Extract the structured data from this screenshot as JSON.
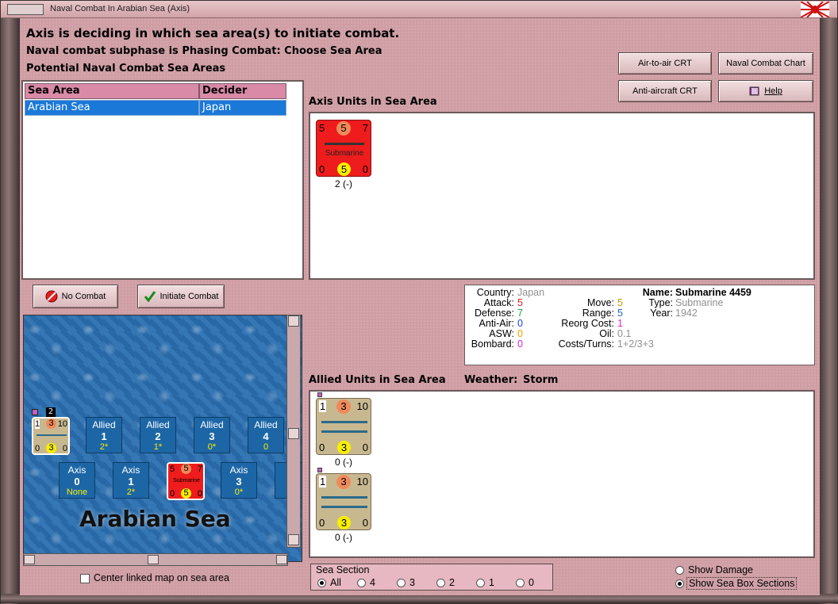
{
  "window": {
    "title": "Naval Combat In Arabian Sea (Axis)"
  },
  "status": {
    "line1": "Axis is deciding in which sea area(s) to initiate combat.",
    "line2": "Naval combat subphase is Phasing Combat: Choose Sea Area",
    "line3": "Potential Naval Combat Sea Areas"
  },
  "buttons": {
    "air_to_air": "Air-to-air CRT",
    "naval_chart": "Naval Combat Chart",
    "anti_aircraft": "Anti-aircraft CRT",
    "help": "Help",
    "no_combat": "No Combat",
    "initiate": "Initiate Combat"
  },
  "table": {
    "headers": [
      "Sea Area",
      "Decider"
    ],
    "rows": [
      [
        "Arabian Sea",
        "Japan"
      ]
    ]
  },
  "axis_section": {
    "label": "Axis Units in Sea Area"
  },
  "axis_unit": {
    "top": [
      "5",
      "5",
      "7"
    ],
    "name": "Submarine",
    "bottom": [
      "0",
      "5",
      "0"
    ],
    "caption": "2 (-)"
  },
  "allied_section": {
    "label": "Allied Units in Sea Area",
    "weather_label": "Weather:",
    "weather_value": "Storm"
  },
  "allied_units": [
    {
      "top": [
        "1",
        "3",
        "10"
      ],
      "bottom": [
        "0",
        "3",
        "0"
      ],
      "caption": "0 (-)"
    },
    {
      "top": [
        "1",
        "3",
        "10"
      ],
      "bottom": [
        "0",
        "3",
        "0"
      ],
      "caption": "0 (-)"
    }
  ],
  "info": {
    "country_label": "Country:",
    "country": "Japan",
    "attack_label": "Attack:",
    "attack": "5",
    "defense_label": "Defense:",
    "defense": "7",
    "antiair_label": "Anti-Air:",
    "antiair": "0",
    "asw_label": "ASW:",
    "asw": "0",
    "bombard_label": "Bombard:",
    "bombard": "0",
    "move_label": "Move:",
    "move": "5",
    "range_label": "Range:",
    "range": "5",
    "reorg_label": "Reorg Cost:",
    "reorg": "1",
    "oil_label": "Oil:",
    "oil": "0.1",
    "costs_label": "Costs/Turns:",
    "costs": "1+2/3+3",
    "name_label": "Name:",
    "name": "Submarine 4459",
    "type_label": "Type:",
    "type": "Submarine",
    "year_label": "Year:",
    "year": "1942",
    "colors": {
      "attack": "#e02020",
      "defense": "#20a040",
      "antiair": "#2040e0",
      "asw": "#f0a000",
      "bombard": "#e020e0",
      "move": "#c0a000",
      "range": "#2060c0",
      "reorg": "#e020e0",
      "gray": "#909090"
    }
  },
  "map": {
    "name": "Arabian Sea",
    "stack_count": "2",
    "mini_counter": {
      "top": [
        "1",
        "3",
        "10"
      ],
      "bottom": [
        "0",
        "3",
        "0"
      ]
    },
    "mini_sub": {
      "top": [
        "5",
        "5",
        "7"
      ],
      "name": "Submarine",
      "bottom": [
        "0",
        "5",
        "0"
      ]
    },
    "allied_boxes": [
      {
        "name": "Allied",
        "num": "1",
        "sub": "2*"
      },
      {
        "name": "Allied",
        "num": "2",
        "sub": "1*"
      },
      {
        "name": "Allied",
        "num": "3",
        "sub": "0*"
      },
      {
        "name": "Allied",
        "num": "4",
        "sub": "0"
      }
    ],
    "axis_boxes": [
      {
        "name": "Axis",
        "num": "0",
        "sub": "None"
      },
      {
        "name": "Axis",
        "num": "1",
        "sub": "2*"
      },
      {
        "name": "Axis",
        "num": "3",
        "sub": "0*"
      },
      {
        "name": "A",
        "num": "",
        "sub": ""
      }
    ]
  },
  "center_map_label": "Center linked map on sea area",
  "sea_section": {
    "label": "Sea Section",
    "options": [
      "All",
      "4",
      "3",
      "2",
      "1",
      "0"
    ],
    "selected": "All"
  },
  "display": {
    "show_damage": "Show Damage",
    "show_boxes": "Show Sea Box Sections"
  }
}
